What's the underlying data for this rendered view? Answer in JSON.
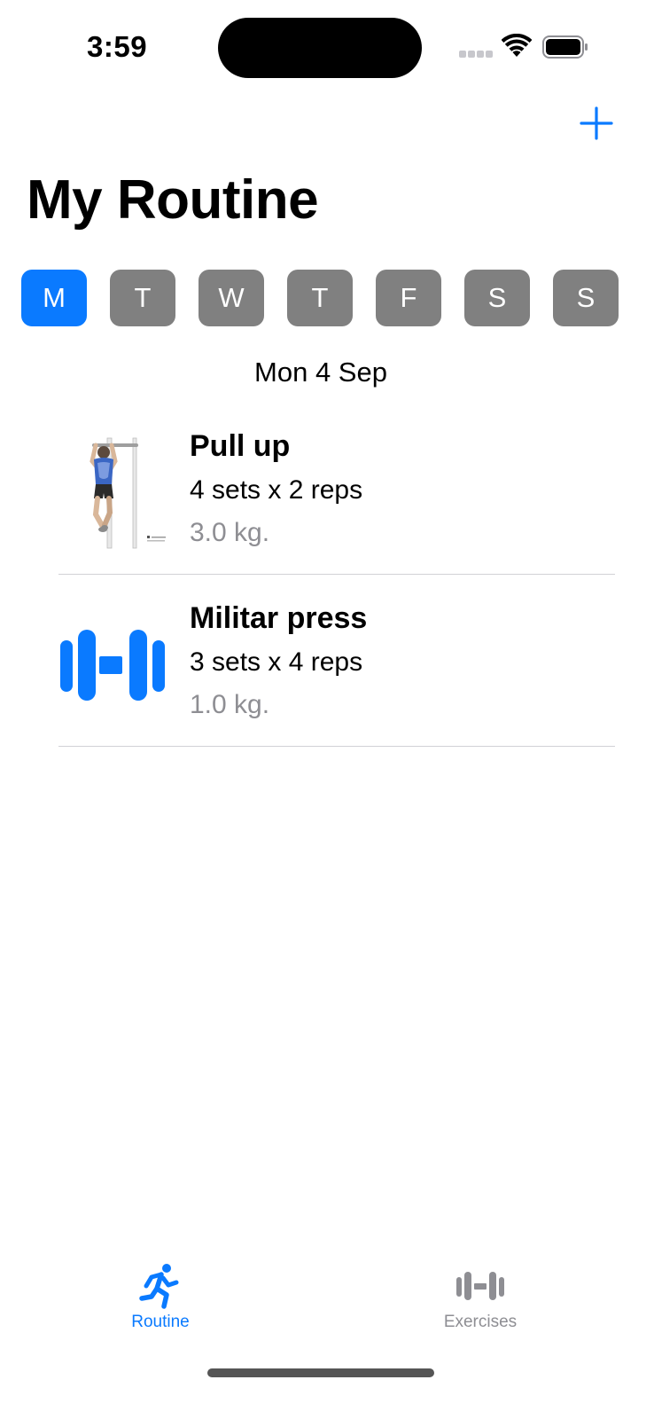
{
  "status_bar": {
    "time": "3:59"
  },
  "nav": {
    "title": "My Routine",
    "add_icon": "plus-icon",
    "accent_color": "#0a7aff"
  },
  "days": [
    {
      "label": "M",
      "selected": true
    },
    {
      "label": "T",
      "selected": false
    },
    {
      "label": "W",
      "selected": false
    },
    {
      "label": "T",
      "selected": false
    },
    {
      "label": "F",
      "selected": false
    },
    {
      "label": "S",
      "selected": false
    },
    {
      "label": "S",
      "selected": false
    }
  ],
  "date_label": "Mon 4 Sep",
  "exercises": [
    {
      "name": "Pull up",
      "sets": "4 sets x 2 reps",
      "weight": "3.0 kg.",
      "thumbnail": "pull-up-illustration"
    },
    {
      "name": "Militar press",
      "sets": "3 sets x 4 reps",
      "weight": "1.0 kg.",
      "thumbnail": "dumbbell-icon"
    }
  ],
  "tabs": [
    {
      "label": "Routine",
      "icon": "running-figure-icon",
      "active": true
    },
    {
      "label": "Exercises",
      "icon": "dumbbell-icon",
      "active": false
    }
  ]
}
